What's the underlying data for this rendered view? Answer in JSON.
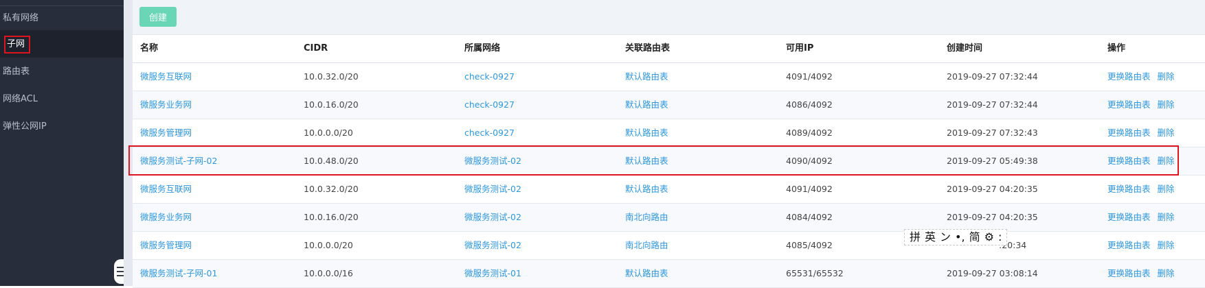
{
  "sidebar": {
    "items": [
      {
        "label": "私有网络",
        "active": false
      },
      {
        "label": "子网",
        "active": true
      },
      {
        "label": "路由表",
        "active": false
      },
      {
        "label": "网络ACL",
        "active": false
      },
      {
        "label": "弹性公网IP",
        "active": false
      }
    ],
    "collapse_icon": "menu-collapse-icon"
  },
  "toolbar": {
    "create_label": "创建"
  },
  "table": {
    "columns": [
      "名称",
      "CIDR",
      "所属网络",
      "关联路由表",
      "可用IP",
      "创建时间",
      "操作"
    ],
    "rows": [
      {
        "name": "微服务互联网",
        "cidr": "10.0.32.0/20",
        "network": "check-0927",
        "route_table": "默认路由表",
        "ip": "4091/4092",
        "created": "2019-09-27 07:32:44"
      },
      {
        "name": "微服务业务网",
        "cidr": "10.0.16.0/20",
        "network": "check-0927",
        "route_table": "默认路由表",
        "ip": "4086/4092",
        "created": "2019-09-27 07:32:44"
      },
      {
        "name": "微服务管理网",
        "cidr": "10.0.0.0/20",
        "network": "check-0927",
        "route_table": "默认路由表",
        "ip": "4089/4092",
        "created": "2019-09-27 07:32:43"
      },
      {
        "name": "微服务测试-子网-02",
        "cidr": "10.0.48.0/20",
        "network": "微服务测试-02",
        "route_table": "默认路由表",
        "ip": "4090/4092",
        "created": "2019-09-27 05:49:38"
      },
      {
        "name": "微服务互联网",
        "cidr": "10.0.32.0/20",
        "network": "微服务测试-02",
        "route_table": "默认路由表",
        "ip": "4091/4092",
        "created": "2019-09-27 04:20:35"
      },
      {
        "name": "微服务业务网",
        "cidr": "10.0.16.0/20",
        "network": "微服务测试-02",
        "route_table": "南北向路由",
        "ip": "4084/4092",
        "created": "2019-09-27 04:20:35"
      },
      {
        "name": "微服务管理网",
        "cidr": "10.0.0.0/20",
        "network": "微服务测试-02",
        "route_table": "南北向路由",
        "ip": "4085/4092",
        "created": ":20:34"
      },
      {
        "name": "微服务测试-子网-01",
        "cidr": "10.0.0.0/16",
        "network": "微服务测试-01",
        "route_table": "默认路由表",
        "ip": "65531/65532",
        "created": "2019-09-27 03:08:14"
      }
    ],
    "actions": {
      "change_route": "更换路由表",
      "delete": "删除"
    },
    "highlighted_row": 3
  },
  "ime_toolbar": {
    "items": [
      "拼",
      "英",
      "ン",
      "•,",
      "简",
      "⚙",
      ":"
    ]
  },
  "colors": {
    "accent": "#69d6b5",
    "link": "#2d97e0",
    "highlight": "#e0141e",
    "sidebar": "#272d3a"
  }
}
